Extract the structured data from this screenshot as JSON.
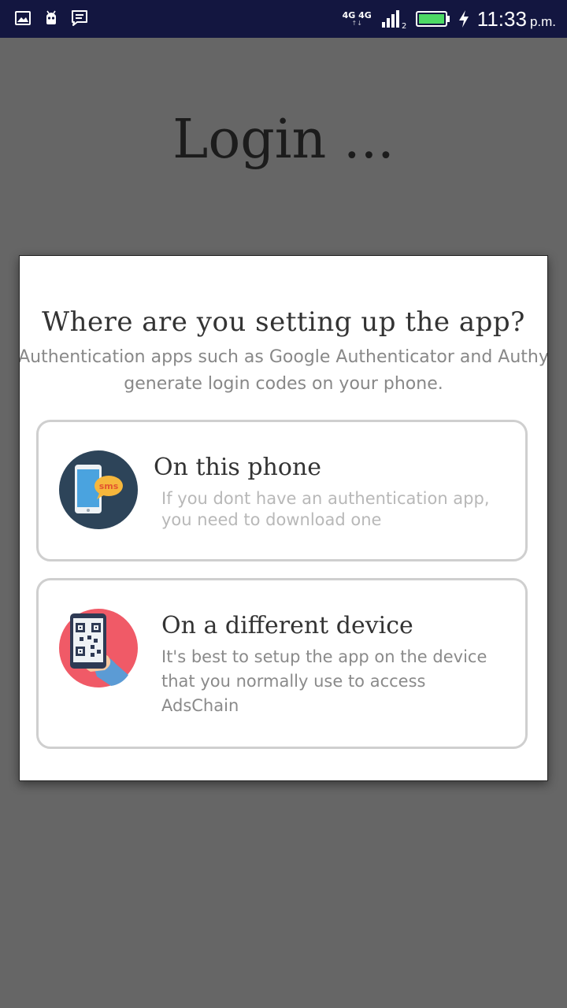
{
  "status_bar": {
    "network_label": "4G 4G",
    "sim_slot": "2",
    "time": "11:33",
    "ampm": "p.m.",
    "battery_color": "#4cd964"
  },
  "background": {
    "title": "Login ..."
  },
  "dialog": {
    "title": "Where are you setting up the app?",
    "subtitle_line1": "Authentication apps such as Google Authenticator and Authy",
    "subtitle_line2": "generate login codes on your phone.",
    "options": [
      {
        "icon": "phone-sms-icon",
        "title": "On this phone",
        "description": "If you dont have an authentication app, you need to download one"
      },
      {
        "icon": "qr-code-hand-icon",
        "title": "On a different device",
        "description": "It's best to setup the app on the device that you normally use to access AdsChain"
      }
    ]
  }
}
